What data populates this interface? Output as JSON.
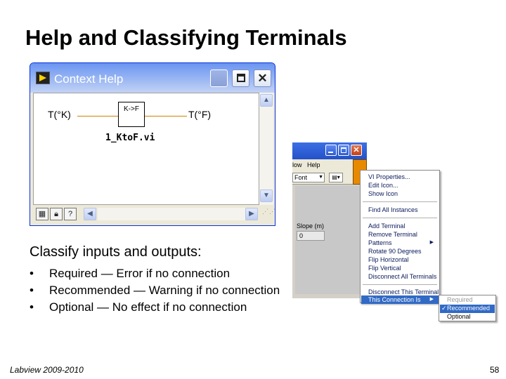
{
  "slide": {
    "title": "Help and Classifying Terminals",
    "footer_left": "Labview 2009-2010",
    "page_number": "58"
  },
  "context_help": {
    "window_title": "Context Help",
    "terminal_in": "T(°K)",
    "terminal_out": "T(°F)",
    "vi_icon_label": "K->F",
    "vi_name": "1_KtoF.vi",
    "icons": [
      "labview-app-icon",
      "minimize-icon",
      "maximize-icon",
      "close-icon",
      "scroll-up-icon",
      "scroll-down-icon",
      "scroll-left-icon",
      "scroll-right-icon",
      "lock-icon",
      "question-icon",
      "detail-icon"
    ]
  },
  "content": {
    "classify_heading": "Classify inputs and outputs:",
    "bullets": [
      "Required — Error if no connection",
      "Recommended — Warning if no connection",
      "Optional — No effect if no connection"
    ],
    "bullet_char": "•"
  },
  "front_panel": {
    "menu_window": "low",
    "menu_help": "Help",
    "font_label": "Font",
    "slope_label": "Slope (m)",
    "slope_value": "0"
  },
  "context_menu": {
    "items": [
      "VI Properties...",
      "Edit Icon...",
      "Show Icon",
      "Find All Instances",
      "Add Terminal",
      "Remove Terminal",
      "Patterns",
      "Rotate 90 Degrees",
      "Flip Horizontal",
      "Flip Vertical",
      "Disconnect All Terminals",
      "Disconnect This Terminal",
      "This Connection Is"
    ],
    "highlight_color": "#316ac5"
  },
  "submenu": {
    "items": [
      "Required",
      "Recommended",
      "Optional"
    ],
    "selected": "Recommended",
    "check_mark": "✓"
  }
}
